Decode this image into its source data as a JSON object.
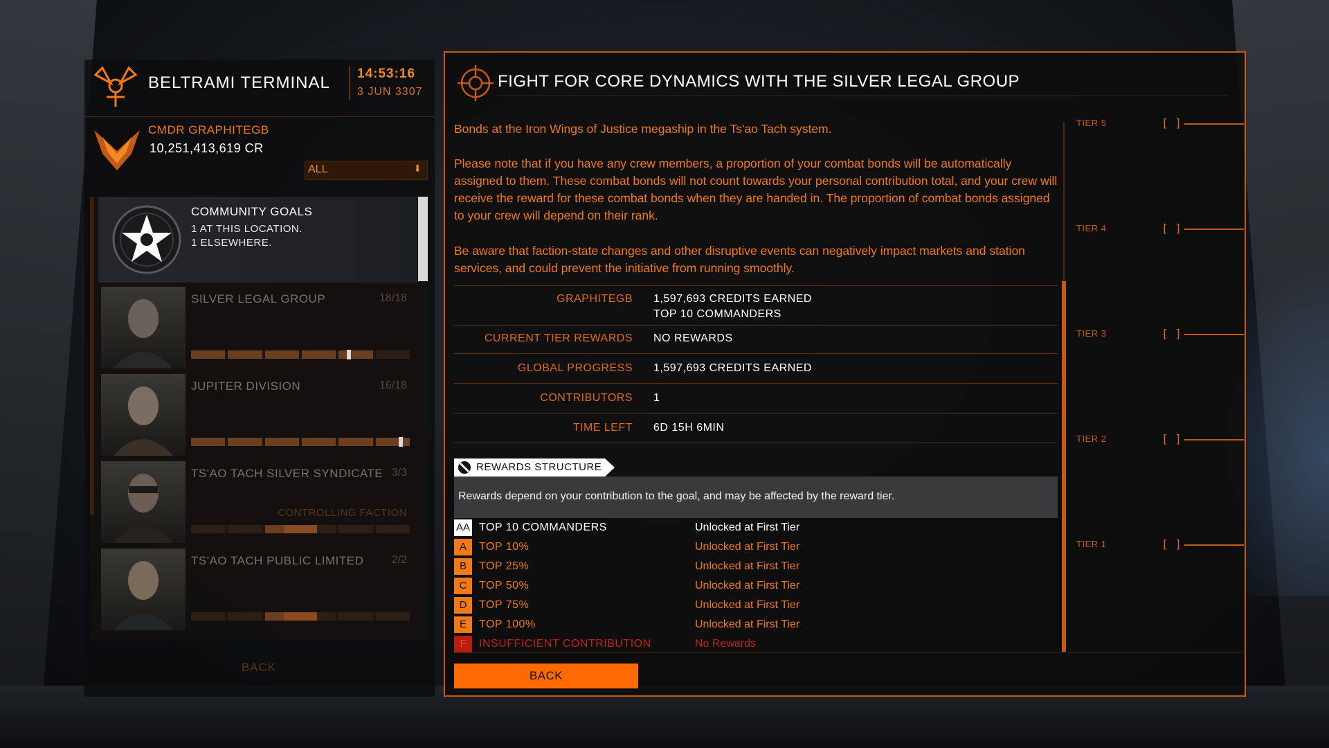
{
  "station": {
    "name": "BELTRAMI TERMINAL",
    "time": "14:53:16",
    "date": "3 JUN 3307"
  },
  "commander": {
    "name": "CMDR GRAPHITEGB",
    "credits": "10,251,413,619 CR"
  },
  "filter": {
    "value": "ALL"
  },
  "community_goals": {
    "title": "COMMUNITY GOALS",
    "line1": "1 AT THIS LOCATION.",
    "line2": "1 ELSEWHERE."
  },
  "factions": [
    {
      "name": "SILVER LEGAL GROUP",
      "count": "18/18",
      "tag": "",
      "level": 0.72
    },
    {
      "name": "JUPITER DIVISION",
      "count": "16/18",
      "tag": "",
      "level": 0.96
    },
    {
      "name": "TS'AO TACH SILVER SYNDICATE",
      "count": "3/3",
      "tag": "CONTROLLING FACTION",
      "level": 0.5
    },
    {
      "name": "TS'AO TACH PUBLIC LIMITED",
      "count": "2/2",
      "tag": "",
      "level": 0.5
    }
  ],
  "left_back_label": "BACK",
  "goal": {
    "title": "FIGHT FOR CORE DYNAMICS WITH THE SILVER LEGAL GROUP",
    "paragraphs": [
      "Bonds at the Iron Wings of Justice megaship in the Ts'ao Tach system.",
      "Please note that if you have any crew members, a proportion of your combat bonds will be automatically assigned to them. These combat bonds will not count towards your personal contribution total, and your crew will receive the reward for these combat bonds when they are handed in. The proportion of combat bonds assigned to your crew will depend on their rank.",
      "Be aware that faction-state changes and other disruptive events can negatively impact markets and station services, and could prevent the initiative from running smoothly."
    ],
    "stats": [
      {
        "label": "GRAPHITEGB",
        "value": "1,597,693 CREDITS EARNED",
        "value2": "TOP 10 COMMANDERS"
      },
      {
        "label": "CURRENT TIER REWARDS",
        "value": "NO REWARDS",
        "value2": ""
      },
      {
        "label": "GLOBAL PROGRESS",
        "value": "1,597,693 CREDITS EARNED",
        "value2": ""
      },
      {
        "label": "CONTRIBUTORS",
        "value": "1",
        "value2": ""
      },
      {
        "label": "TIME LEFT",
        "value": "6D 15H 6MIN",
        "value2": ""
      }
    ],
    "rewards_header": "REWARDS STRUCTURE",
    "rewards_note": "Rewards depend on your contribution to the goal, and may be affected by the reward tier.",
    "rewards": [
      {
        "grade": "AA",
        "name": "TOP 10 COMMANDERS",
        "status": "Unlocked at First Tier"
      },
      {
        "grade": "A",
        "name": "TOP 10%",
        "status": "Unlocked at First Tier"
      },
      {
        "grade": "B",
        "name": "TOP 25%",
        "status": "Unlocked at First Tier"
      },
      {
        "grade": "C",
        "name": "TOP 50%",
        "status": "Unlocked at First Tier"
      },
      {
        "grade": "D",
        "name": "TOP 75%",
        "status": "Unlocked at First Tier"
      },
      {
        "grade": "E",
        "name": "TOP 100%",
        "status": "Unlocked at First Tier"
      },
      {
        "grade": "F",
        "name": "INSUFFICIENT CONTRIBUTION",
        "status": "No Rewards"
      }
    ],
    "back_label": "BACK",
    "tiers": [
      "TIER 5",
      "TIER 4",
      "TIER 3",
      "TIER 2",
      "TIER 1"
    ],
    "tier_marker": "[ ]"
  },
  "colors": {
    "accent": "#f07a1a",
    "button": "#ff6a00",
    "danger": "#c0231a"
  }
}
